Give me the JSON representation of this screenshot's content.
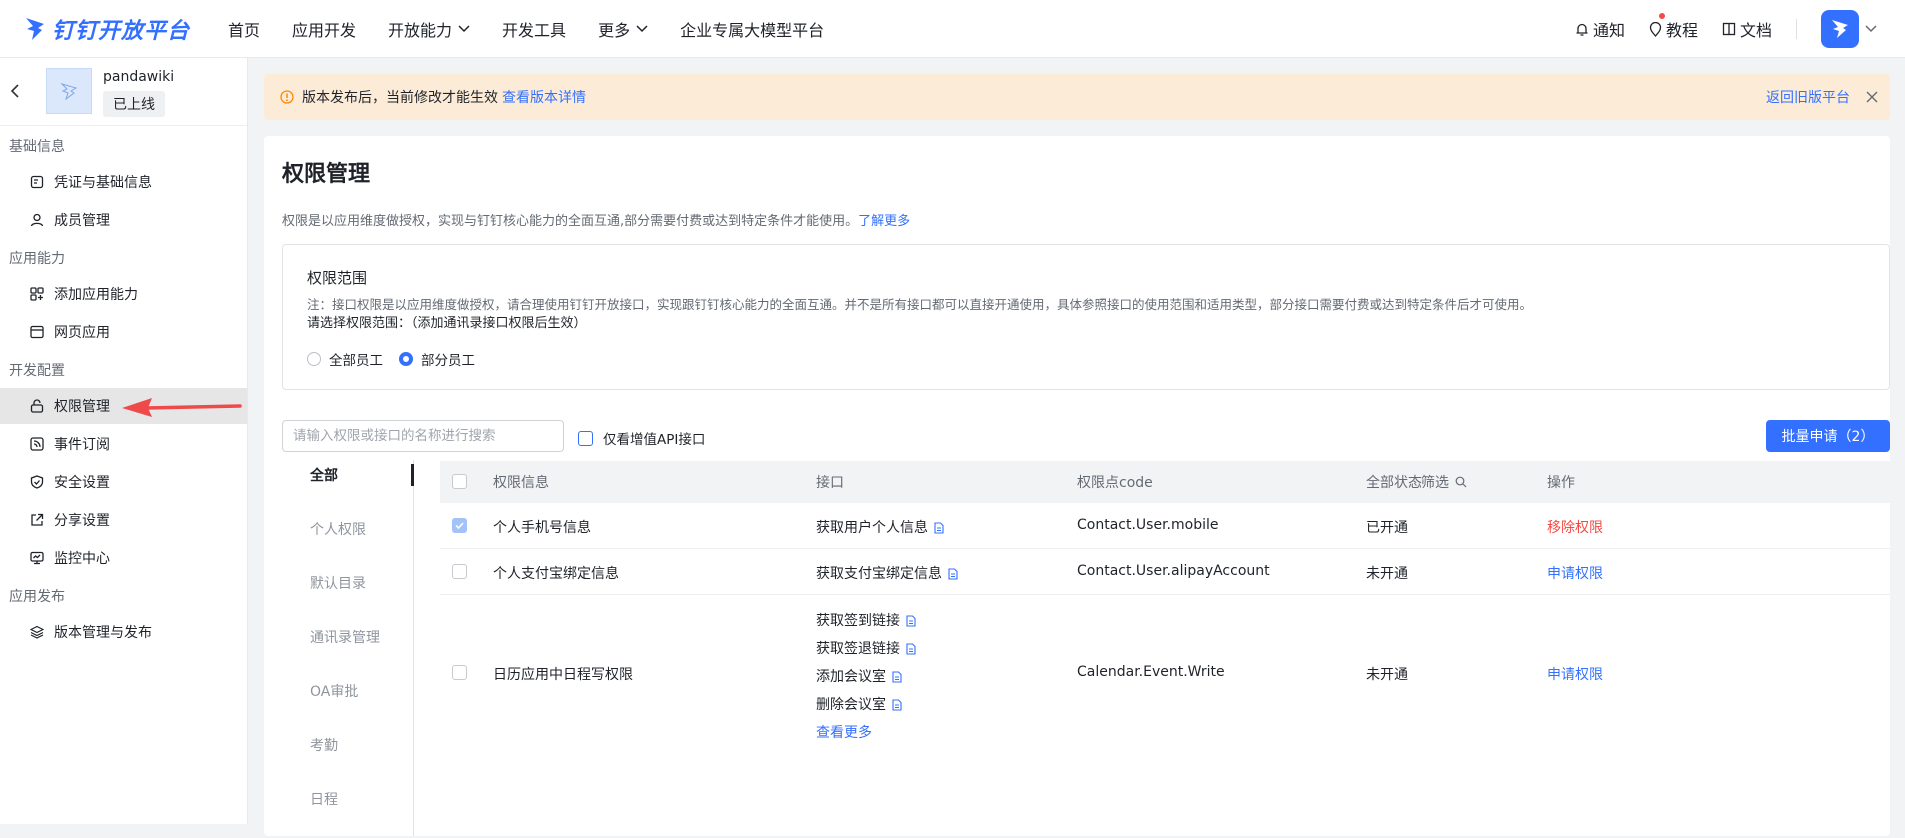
{
  "header": {
    "logo_text": "钉钉开放平台",
    "nav": [
      {
        "label": "首页",
        "has_menu": false
      },
      {
        "label": "应用开发",
        "has_menu": false
      },
      {
        "label": "开放能力",
        "has_menu": true
      },
      {
        "label": "开发工具",
        "has_menu": false
      },
      {
        "label": "更多",
        "has_menu": true
      },
      {
        "label": "企业专属大模型平台",
        "has_menu": false
      }
    ],
    "notify": "通知",
    "tutorial": "教程",
    "docs": "文档"
  },
  "sidebar": {
    "app_name": "pandawiki",
    "app_status": "已上线",
    "groups": {
      "basic": "基础信息",
      "ability": "应用能力",
      "dev": "开发配置",
      "publish": "应用发布"
    },
    "items": {
      "credentials": "凭证与基础信息",
      "members": "成员管理",
      "add_ability": "添加应用能力",
      "web_app": "网页应用",
      "permission": "权限管理",
      "events": "事件订阅",
      "security": "安全设置",
      "share": "分享设置",
      "monitor": "监控中心",
      "version": "版本管理与发布"
    }
  },
  "notice": {
    "text": "版本发布后，当前修改才能生效",
    "link": "查看版本详情",
    "back_old": "返回旧版平台"
  },
  "page": {
    "title": "权限管理",
    "desc": "权限是以应用维度做授权，实现与钉钉核心能力的全面互通,部分需要付费或达到特定条件才能使用。",
    "learn_more": "了解更多"
  },
  "scope": {
    "title": "权限范围",
    "note": "注：接口权限是以应用维度做授权，请合理使用钉钉开放接口，实现跟钉钉核心能力的全面互通。并不是所有接口都可以直接开通使用，具体参照接口的使用范围和适用类型，部分接口需要付费或达到特定条件后才可使用。",
    "choose": "请选择权限范围：（添加通讯录接口权限后生效）",
    "options": [
      "全部员工",
      "部分员工"
    ],
    "selected": "部分员工"
  },
  "toolbar": {
    "search_placeholder": "请输入权限或接口的名称进行搜索",
    "only_value_added": "仅看增值API接口",
    "batch_apply": "批量申请（2）"
  },
  "categories": [
    "全部",
    "个人权限",
    "默认目录",
    "通讯录管理",
    "OA审批",
    "考勤",
    "日程"
  ],
  "active_category": "全部",
  "table": {
    "headers": {
      "info": "权限信息",
      "api": "接口",
      "code": "权限点code",
      "status": "全部状态",
      "filter": "筛选",
      "action": "操作"
    },
    "rows": [
      {
        "name": "个人手机号信息",
        "apis": [
          "获取用户个人信息"
        ],
        "code": "Contact.User.mobile",
        "status": "已开通",
        "action": "移除权限",
        "checked": true
      },
      {
        "name": "个人支付宝绑定信息",
        "apis": [
          "获取支付宝绑定信息"
        ],
        "code": "Contact.User.alipayAccount",
        "status": "未开通",
        "action": "申请权限",
        "checked": false
      },
      {
        "name": "日历应用中日程写权限",
        "apis": [
          "获取签到链接",
          "获取签退链接",
          "添加会议室",
          "删除会议室"
        ],
        "more": "查看更多",
        "code": "Calendar.Event.Write",
        "status": "未开通",
        "action": "申请权限",
        "checked": false
      }
    ]
  },
  "colors": {
    "accent": "#3370ff",
    "danger": "#f54a45",
    "notice_bg": "#fcecd7"
  }
}
